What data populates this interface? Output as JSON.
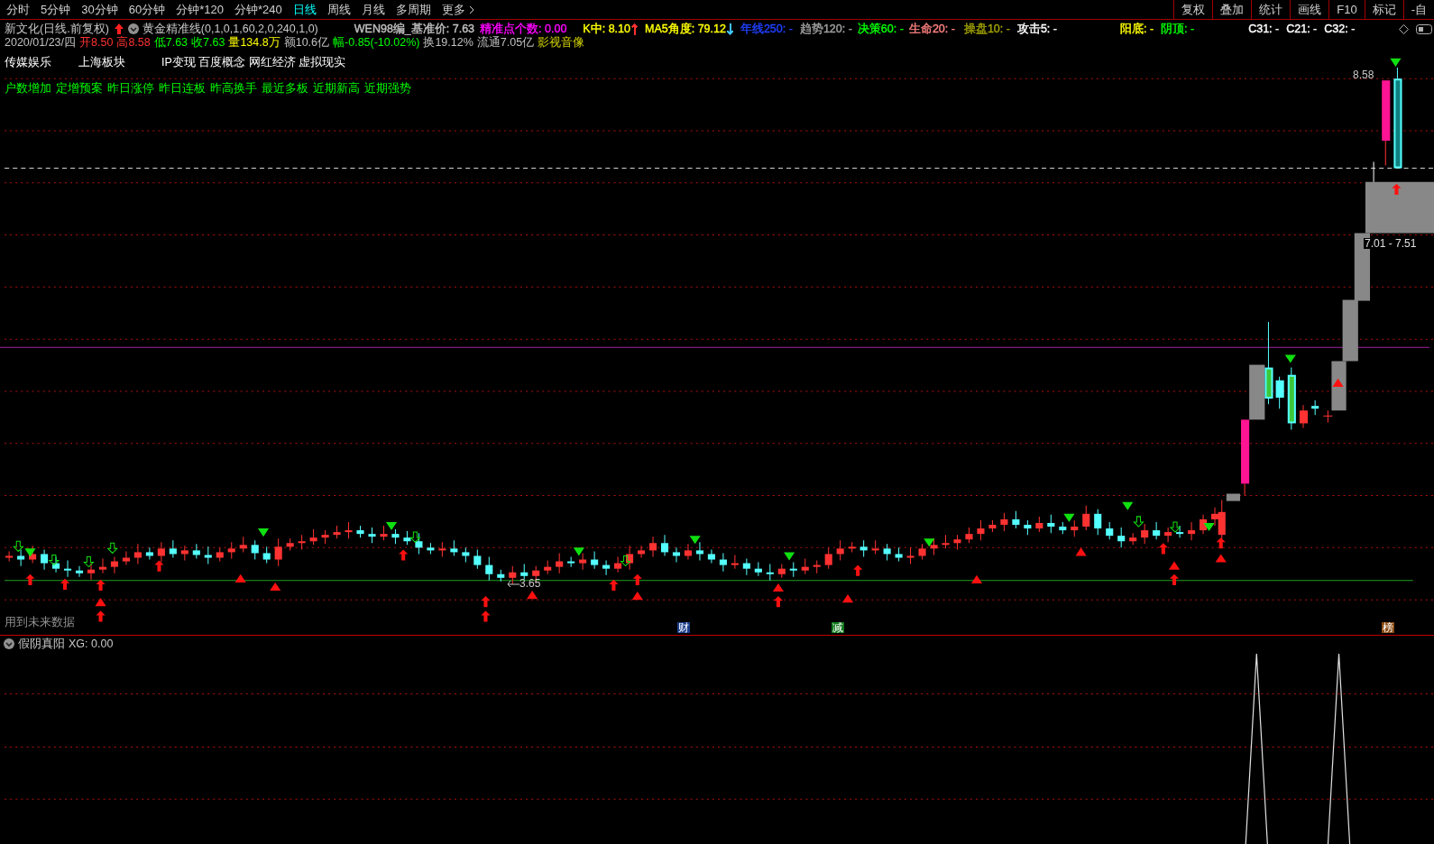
{
  "toolbar": {
    "periods": [
      {
        "label": "分时",
        "selected": false
      },
      {
        "label": "5分钟",
        "selected": false
      },
      {
        "label": "30分钟",
        "selected": false
      },
      {
        "label": "60分钟",
        "selected": false
      },
      {
        "label": "分钟*120",
        "selected": false
      },
      {
        "label": "分钟*240",
        "selected": false
      },
      {
        "label": "日线",
        "selected": true
      },
      {
        "label": "周线",
        "selected": false
      },
      {
        "label": "月线",
        "selected": false
      },
      {
        "label": "多周期",
        "selected": false
      },
      {
        "label": "更多",
        "selected": false
      }
    ],
    "buttons": [
      "复权",
      "叠加",
      "统计",
      "画线",
      "F10",
      "标记",
      "-自"
    ]
  },
  "header": {
    "stock": "新文化(日线.前复权)",
    "indicator": "黄金精准线(0,1,0,1,60,2,0,240,1,0)",
    "values": [
      {
        "text": "WEN98编_基准价: 7.63",
        "color": "#c0c0c0"
      },
      {
        "text": "精准点个数: 0.00",
        "color": "#ff00ff"
      },
      {
        "text": "K中: 8.10",
        "color": "#ffff00",
        "arrow": {
          "kind": "up",
          "color": "#ff3030"
        }
      },
      {
        "text": "MA5角度: 79.12",
        "color": "#ffff00",
        "arrow": {
          "kind": "down",
          "color": "#40c0ff"
        }
      },
      {
        "text": "年线250: -",
        "color": "#2040ff"
      },
      {
        "text": "趋势120: -",
        "color": "#a0a0a0"
      },
      {
        "text": "决策60: -",
        "color": "#00ff00"
      },
      {
        "text": "生命20: -",
        "color": "#ff8080"
      },
      {
        "text": "操盘10: -",
        "color": "#a0a000"
      },
      {
        "text": "攻击5: -",
        "color": "#ffffff"
      },
      {
        "text": "阳底: -",
        "color": "#ffff00"
      },
      {
        "text": "阴顶: -",
        "color": "#00ff00"
      },
      {
        "text": "C31: -",
        "color": "#ffffff"
      },
      {
        "text": "C21: -",
        "color": "#ffffff"
      },
      {
        "text": "C32: -",
        "color": "#ffffff"
      }
    ],
    "quote": [
      {
        "text": "2020/01/23/四",
        "color": "#c0c0c0"
      },
      {
        "text": "开8.50",
        "color": "#ff3232"
      },
      {
        "text": "高8.58",
        "color": "#ff3232"
      },
      {
        "text": "低7.63",
        "color": "#00ff00"
      },
      {
        "text": "收7.63",
        "color": "#00ff00"
      },
      {
        "text": "量134.8万",
        "color": "#ffff00"
      },
      {
        "text": "额10.6亿",
        "color": "#c0c0c0"
      },
      {
        "text": "幅-0.85(-10.02%)",
        "color": "#00ff00"
      },
      {
        "text": "换19.12%",
        "color": "#c0c0c0"
      },
      {
        "text": "流通7.05亿",
        "color": "#c0c0c0"
      },
      {
        "text": "影视音像",
        "color": "#d0d000"
      }
    ],
    "sectors": [
      "传媒娱乐",
      "上海板块",
      "IP变现 百度概念 网红经济 虚拟现实"
    ],
    "tags": [
      "户数增加",
      "定增预案",
      "昨日涨停",
      "昨日连板",
      "昨高换手",
      "最近多板",
      "近期新高",
      "近期强势"
    ]
  },
  "chart": {
    "high_label": "8.58",
    "range_label": "7.01 - 7.51",
    "low_label": "3.65",
    "note": "用到未来数据",
    "badges": [
      {
        "text": "财",
        "color": "#1c3d8c"
      },
      {
        "text": "减",
        "color": "#137a1e"
      },
      {
        "text": "榜",
        "color": "#8a4b14"
      }
    ]
  },
  "subpanel": {
    "name": "假阴真阳",
    "value": "XG: 0.00"
  }
}
